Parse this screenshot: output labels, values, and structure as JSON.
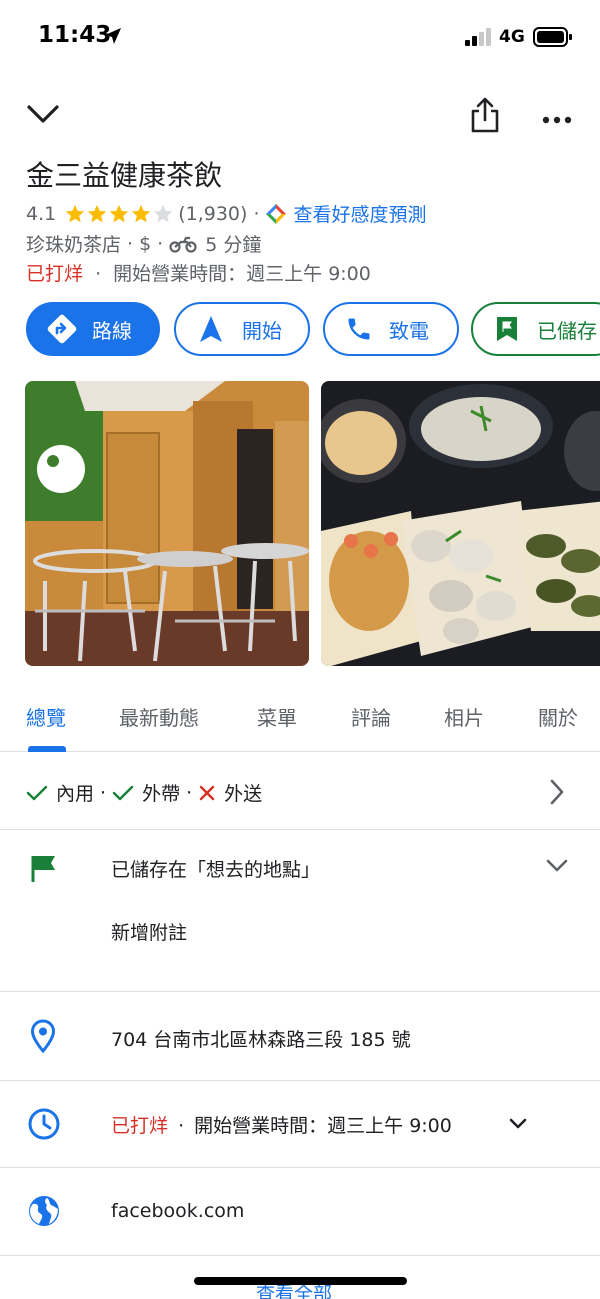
{
  "status_bar": {
    "time": "11:43",
    "network": "4G"
  },
  "place": {
    "name": "金三益健康茶飲",
    "rating": "4.1",
    "rating_value": 4.1,
    "review_count": "(1,930)",
    "vibe_link": "查看好感度預測",
    "category": "珍珠奶茶店",
    "price": "$",
    "travel_time": "5 分鐘",
    "status": "已打烊",
    "hours_text": "開始營業時間：週三上午 9:00"
  },
  "actions": {
    "directions": "路線",
    "start": "開始",
    "call": "致電",
    "saved": "已儲存"
  },
  "tabs": [
    "總覽",
    "最新動態",
    "菜單",
    "評論",
    "相片",
    "關於"
  ],
  "services": {
    "dine_in": "內用",
    "takeout": "外帶",
    "delivery": "外送"
  },
  "saved_list": {
    "label": "已儲存在「想去的地點」",
    "add_note": "新增附註"
  },
  "address": "704 台南市北區林森路三段 185 號",
  "hours": {
    "status": "已打烊",
    "text": "開始營業時間：週三上午 9:00"
  },
  "website": "facebook.com",
  "see_all": "查看全部",
  "colors": {
    "accent": "#1a73e8",
    "closed": "#d93025",
    "saved": "#188038",
    "star": "#fbbc04"
  }
}
